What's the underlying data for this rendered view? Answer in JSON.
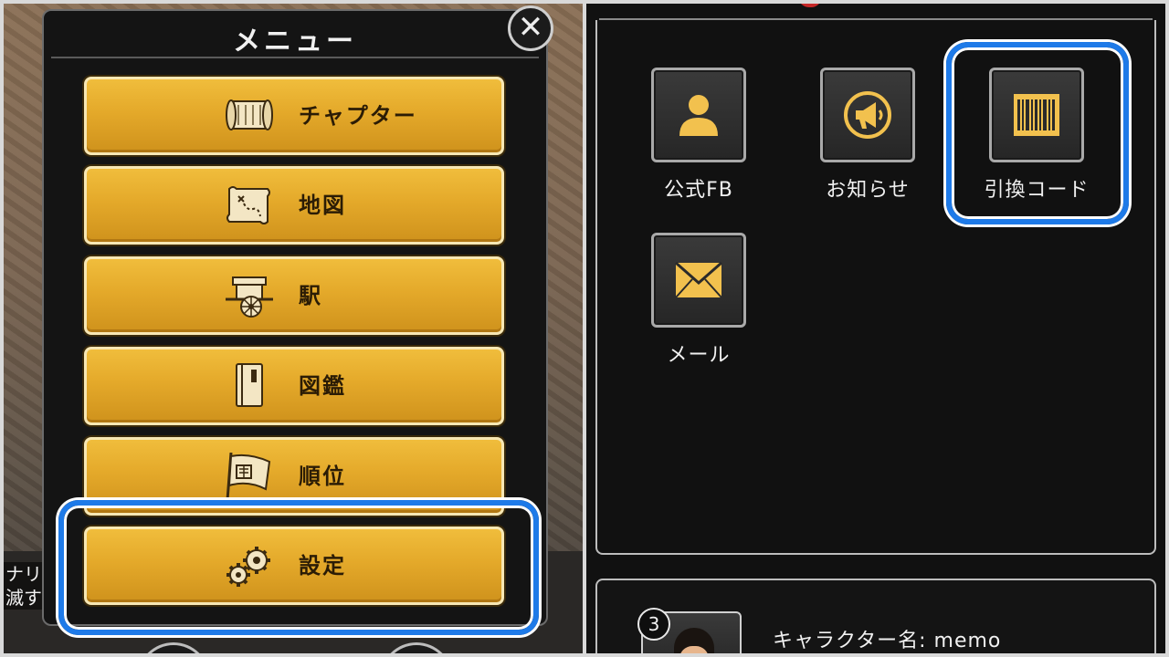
{
  "menu": {
    "title": "メニュー",
    "close_icon": "close-icon",
    "items": [
      {
        "label": "チャプター",
        "icon": "scroll-icon"
      },
      {
        "label": "地図",
        "icon": "map-icon"
      },
      {
        "label": "駅",
        "icon": "carriage-icon"
      },
      {
        "label": "図鑑",
        "icon": "book-icon"
      },
      {
        "label": "順位",
        "icon": "flag-icon"
      },
      {
        "label": "設定",
        "icon": "gears-icon"
      }
    ],
    "highlighted": "設定"
  },
  "background": {
    "side_text": [
      "ナリ",
      "滅す"
    ]
  },
  "settings_panel": {
    "tiles": [
      {
        "label": "公式FB",
        "icon": "person-icon"
      },
      {
        "label": "お知らせ",
        "icon": "megaphone-icon"
      },
      {
        "label": "引換コード",
        "icon": "barcode-icon"
      },
      {
        "label": "メール",
        "icon": "envelope-icon"
      }
    ],
    "highlighted": "引換コード"
  },
  "character": {
    "level": "3",
    "name_text": "キャラクター名: memo"
  },
  "colors": {
    "highlight": "#1e7ae8",
    "button_gold": "#e4a92a",
    "icon_gold": "#f2c14e"
  }
}
